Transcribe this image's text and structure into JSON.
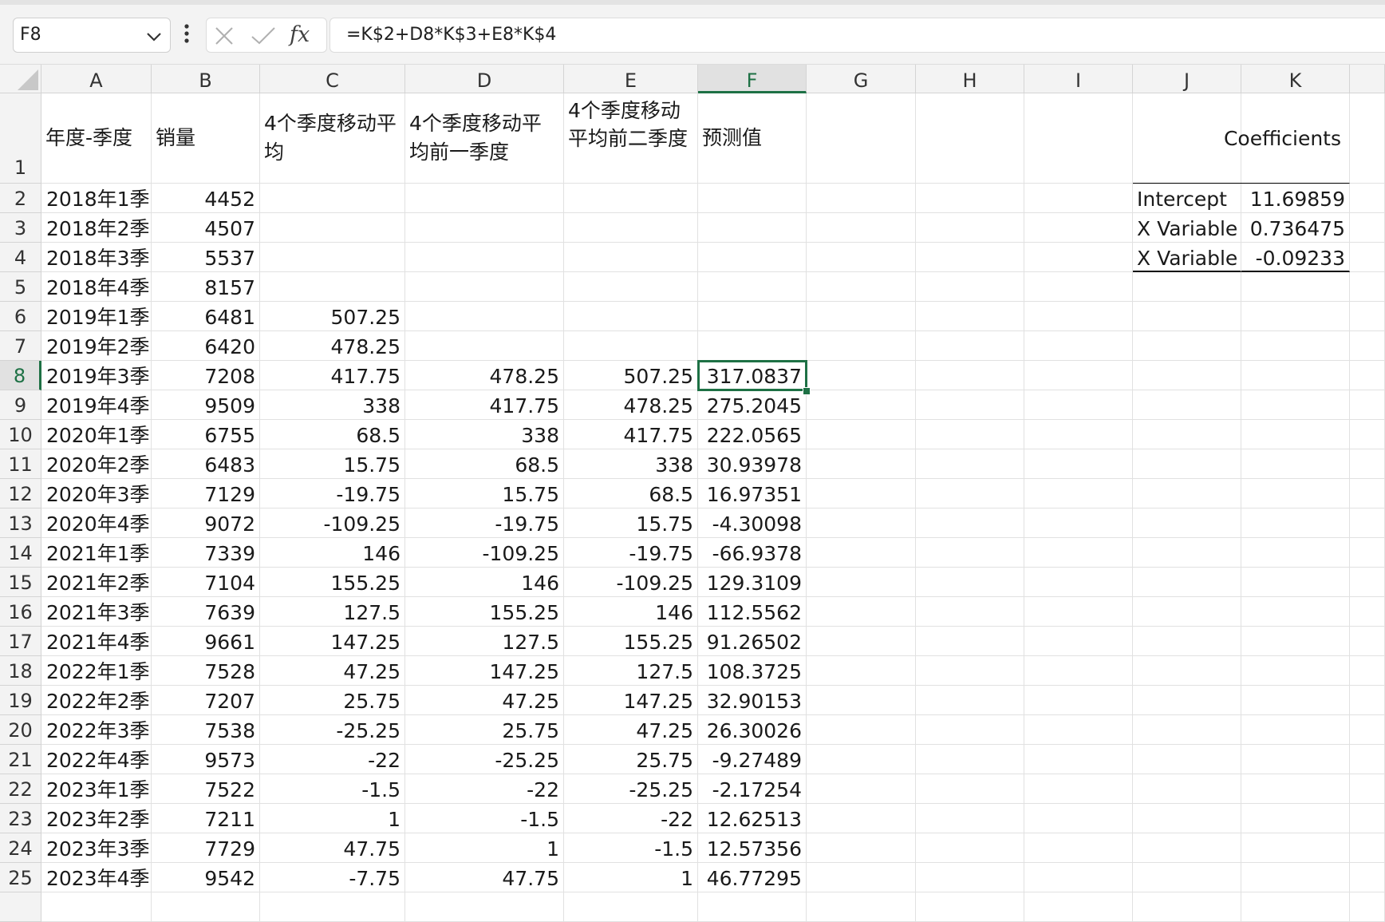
{
  "formula_bar": {
    "name_box": "F8",
    "fx_label": "fx",
    "formula": "=K$2+D8*K$3+E8*K$4"
  },
  "columns": [
    "A",
    "B",
    "C",
    "D",
    "E",
    "F",
    "G",
    "H",
    "I",
    "J",
    "K"
  ],
  "selected": {
    "column": "F",
    "row": 8
  },
  "header_row": {
    "A": "年度-季度",
    "B": "销量",
    "C": "4个季度移动平均",
    "D": "4个季度移动平均前一季度",
    "E": "4个季度移动平均前二季度",
    "F": "预测值",
    "K": "Coefficients"
  },
  "rows": [
    {
      "n": 2,
      "A": "2018年1季",
      "B": "4452",
      "C": "",
      "D": "",
      "E": "",
      "F": "",
      "J": "Intercept",
      "K": "11.69859"
    },
    {
      "n": 3,
      "A": "2018年2季",
      "B": "4507",
      "C": "",
      "D": "",
      "E": "",
      "F": "",
      "J": "X Variable",
      "K": "0.736475"
    },
    {
      "n": 4,
      "A": "2018年3季",
      "B": "5537",
      "C": "",
      "D": "",
      "E": "",
      "F": "",
      "J": "X Variable",
      "K": "-0.09233"
    },
    {
      "n": 5,
      "A": "2018年4季",
      "B": "8157",
      "C": "",
      "D": "",
      "E": "",
      "F": ""
    },
    {
      "n": 6,
      "A": "2019年1季",
      "B": "6481",
      "C": "507.25",
      "D": "",
      "E": "",
      "F": ""
    },
    {
      "n": 7,
      "A": "2019年2季",
      "B": "6420",
      "C": "478.25",
      "D": "",
      "E": "",
      "F": ""
    },
    {
      "n": 8,
      "A": "2019年3季",
      "B": "7208",
      "C": "417.75",
      "D": "478.25",
      "E": "507.25",
      "F": "317.0837"
    },
    {
      "n": 9,
      "A": "2019年4季",
      "B": "9509",
      "C": "338",
      "D": "417.75",
      "E": "478.25",
      "F": "275.2045"
    },
    {
      "n": 10,
      "A": "2020年1季",
      "B": "6755",
      "C": "68.5",
      "D": "338",
      "E": "417.75",
      "F": "222.0565"
    },
    {
      "n": 11,
      "A": "2020年2季",
      "B": "6483",
      "C": "15.75",
      "D": "68.5",
      "E": "338",
      "F": "30.93978"
    },
    {
      "n": 12,
      "A": "2020年3季",
      "B": "7129",
      "C": "-19.75",
      "D": "15.75",
      "E": "68.5",
      "F": "16.97351"
    },
    {
      "n": 13,
      "A": "2020年4季",
      "B": "9072",
      "C": "-109.25",
      "D": "-19.75",
      "E": "15.75",
      "F": "-4.30098"
    },
    {
      "n": 14,
      "A": "2021年1季",
      "B": "7339",
      "C": "146",
      "D": "-109.25",
      "E": "-19.75",
      "F": "-66.9378"
    },
    {
      "n": 15,
      "A": "2021年2季",
      "B": "7104",
      "C": "155.25",
      "D": "146",
      "E": "-109.25",
      "F": "129.3109"
    },
    {
      "n": 16,
      "A": "2021年3季",
      "B": "7639",
      "C": "127.5",
      "D": "155.25",
      "E": "146",
      "F": "112.5562"
    },
    {
      "n": 17,
      "A": "2021年4季",
      "B": "9661",
      "C": "147.25",
      "D": "127.5",
      "E": "155.25",
      "F": "91.26502"
    },
    {
      "n": 18,
      "A": "2022年1季",
      "B": "7528",
      "C": "47.25",
      "D": "147.25",
      "E": "127.5",
      "F": "108.3725"
    },
    {
      "n": 19,
      "A": "2022年2季",
      "B": "7207",
      "C": "25.75",
      "D": "47.25",
      "E": "147.25",
      "F": "32.90153"
    },
    {
      "n": 20,
      "A": "2022年3季",
      "B": "7538",
      "C": "-25.25",
      "D": "25.75",
      "E": "47.25",
      "F": "26.30026"
    },
    {
      "n": 21,
      "A": "2022年4季",
      "B": "9573",
      "C": "-22",
      "D": "-25.25",
      "E": "25.75",
      "F": "-9.27489"
    },
    {
      "n": 22,
      "A": "2023年1季",
      "B": "7522",
      "C": "-1.5",
      "D": "-22",
      "E": "-25.25",
      "F": "-2.17254"
    },
    {
      "n": 23,
      "A": "2023年2季",
      "B": "7211",
      "C": "1",
      "D": "-1.5",
      "E": "-22",
      "F": "12.62513"
    },
    {
      "n": 24,
      "A": "2023年3季",
      "B": "7729",
      "C": "47.75",
      "D": "1",
      "E": "-1.5",
      "F": "12.57356"
    },
    {
      "n": 25,
      "A": "2023年4季",
      "B": "9542",
      "C": "-7.75",
      "D": "47.75",
      "E": "1",
      "F": "46.77295"
    }
  ],
  "colors": {
    "accent": "#1e7145",
    "header_bg": "#f3f3f3",
    "gridline": "#e1e1e1"
  }
}
